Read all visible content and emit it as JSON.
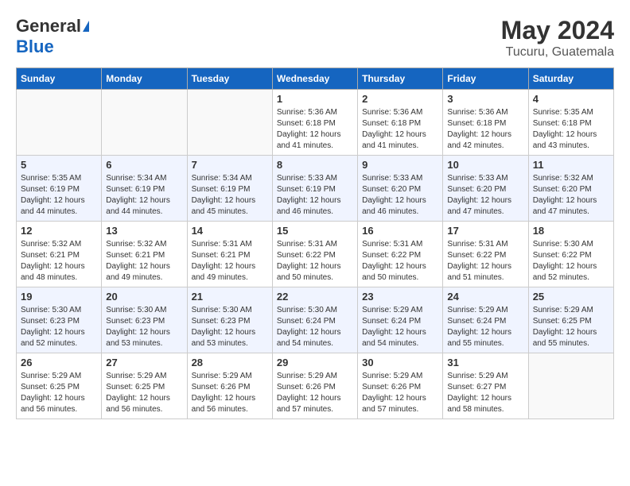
{
  "header": {
    "logo_general": "General",
    "logo_blue": "Blue",
    "month_year": "May 2024",
    "location": "Tucuru, Guatemala"
  },
  "days_of_week": [
    "Sunday",
    "Monday",
    "Tuesday",
    "Wednesday",
    "Thursday",
    "Friday",
    "Saturday"
  ],
  "weeks": [
    [
      {
        "day": "",
        "info": ""
      },
      {
        "day": "",
        "info": ""
      },
      {
        "day": "",
        "info": ""
      },
      {
        "day": "1",
        "info": "Sunrise: 5:36 AM\nSunset: 6:18 PM\nDaylight: 12 hours\nand 41 minutes."
      },
      {
        "day": "2",
        "info": "Sunrise: 5:36 AM\nSunset: 6:18 PM\nDaylight: 12 hours\nand 41 minutes."
      },
      {
        "day": "3",
        "info": "Sunrise: 5:36 AM\nSunset: 6:18 PM\nDaylight: 12 hours\nand 42 minutes."
      },
      {
        "day": "4",
        "info": "Sunrise: 5:35 AM\nSunset: 6:18 PM\nDaylight: 12 hours\nand 43 minutes."
      }
    ],
    [
      {
        "day": "5",
        "info": "Sunrise: 5:35 AM\nSunset: 6:19 PM\nDaylight: 12 hours\nand 44 minutes."
      },
      {
        "day": "6",
        "info": "Sunrise: 5:34 AM\nSunset: 6:19 PM\nDaylight: 12 hours\nand 44 minutes."
      },
      {
        "day": "7",
        "info": "Sunrise: 5:34 AM\nSunset: 6:19 PM\nDaylight: 12 hours\nand 45 minutes."
      },
      {
        "day": "8",
        "info": "Sunrise: 5:33 AM\nSunset: 6:19 PM\nDaylight: 12 hours\nand 46 minutes."
      },
      {
        "day": "9",
        "info": "Sunrise: 5:33 AM\nSunset: 6:20 PM\nDaylight: 12 hours\nand 46 minutes."
      },
      {
        "day": "10",
        "info": "Sunrise: 5:33 AM\nSunset: 6:20 PM\nDaylight: 12 hours\nand 47 minutes."
      },
      {
        "day": "11",
        "info": "Sunrise: 5:32 AM\nSunset: 6:20 PM\nDaylight: 12 hours\nand 47 minutes."
      }
    ],
    [
      {
        "day": "12",
        "info": "Sunrise: 5:32 AM\nSunset: 6:21 PM\nDaylight: 12 hours\nand 48 minutes."
      },
      {
        "day": "13",
        "info": "Sunrise: 5:32 AM\nSunset: 6:21 PM\nDaylight: 12 hours\nand 49 minutes."
      },
      {
        "day": "14",
        "info": "Sunrise: 5:31 AM\nSunset: 6:21 PM\nDaylight: 12 hours\nand 49 minutes."
      },
      {
        "day": "15",
        "info": "Sunrise: 5:31 AM\nSunset: 6:22 PM\nDaylight: 12 hours\nand 50 minutes."
      },
      {
        "day": "16",
        "info": "Sunrise: 5:31 AM\nSunset: 6:22 PM\nDaylight: 12 hours\nand 50 minutes."
      },
      {
        "day": "17",
        "info": "Sunrise: 5:31 AM\nSunset: 6:22 PM\nDaylight: 12 hours\nand 51 minutes."
      },
      {
        "day": "18",
        "info": "Sunrise: 5:30 AM\nSunset: 6:22 PM\nDaylight: 12 hours\nand 52 minutes."
      }
    ],
    [
      {
        "day": "19",
        "info": "Sunrise: 5:30 AM\nSunset: 6:23 PM\nDaylight: 12 hours\nand 52 minutes."
      },
      {
        "day": "20",
        "info": "Sunrise: 5:30 AM\nSunset: 6:23 PM\nDaylight: 12 hours\nand 53 minutes."
      },
      {
        "day": "21",
        "info": "Sunrise: 5:30 AM\nSunset: 6:23 PM\nDaylight: 12 hours\nand 53 minutes."
      },
      {
        "day": "22",
        "info": "Sunrise: 5:30 AM\nSunset: 6:24 PM\nDaylight: 12 hours\nand 54 minutes."
      },
      {
        "day": "23",
        "info": "Sunrise: 5:29 AM\nSunset: 6:24 PM\nDaylight: 12 hours\nand 54 minutes."
      },
      {
        "day": "24",
        "info": "Sunrise: 5:29 AM\nSunset: 6:24 PM\nDaylight: 12 hours\nand 55 minutes."
      },
      {
        "day": "25",
        "info": "Sunrise: 5:29 AM\nSunset: 6:25 PM\nDaylight: 12 hours\nand 55 minutes."
      }
    ],
    [
      {
        "day": "26",
        "info": "Sunrise: 5:29 AM\nSunset: 6:25 PM\nDaylight: 12 hours\nand 56 minutes."
      },
      {
        "day": "27",
        "info": "Sunrise: 5:29 AM\nSunset: 6:25 PM\nDaylight: 12 hours\nand 56 minutes."
      },
      {
        "day": "28",
        "info": "Sunrise: 5:29 AM\nSunset: 6:26 PM\nDaylight: 12 hours\nand 56 minutes."
      },
      {
        "day": "29",
        "info": "Sunrise: 5:29 AM\nSunset: 6:26 PM\nDaylight: 12 hours\nand 57 minutes."
      },
      {
        "day": "30",
        "info": "Sunrise: 5:29 AM\nSunset: 6:26 PM\nDaylight: 12 hours\nand 57 minutes."
      },
      {
        "day": "31",
        "info": "Sunrise: 5:29 AM\nSunset: 6:27 PM\nDaylight: 12 hours\nand 58 minutes."
      },
      {
        "day": "",
        "info": ""
      }
    ]
  ]
}
